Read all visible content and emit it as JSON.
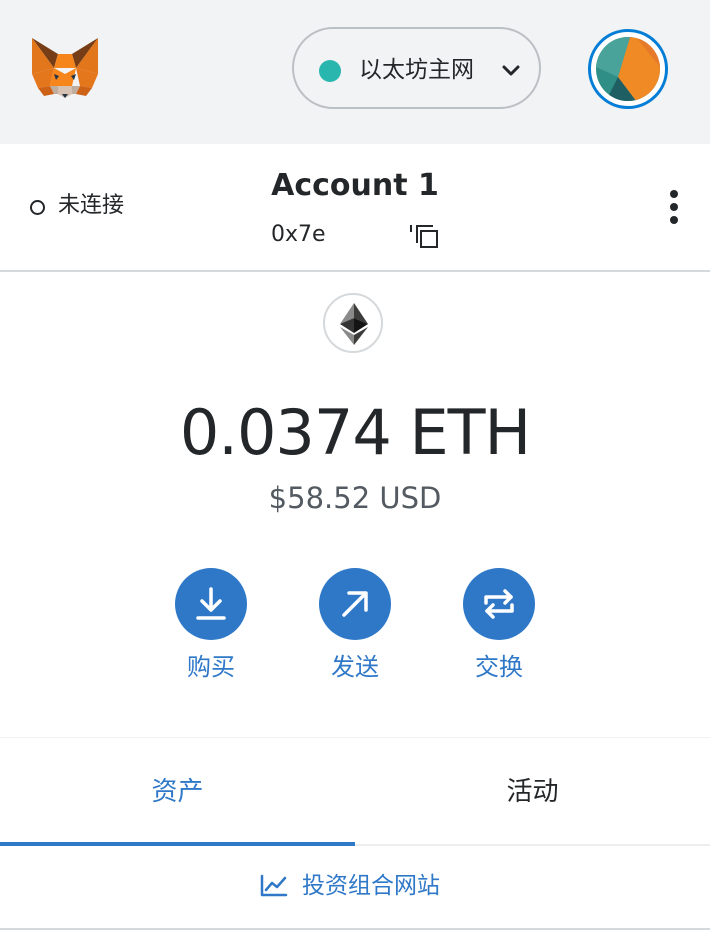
{
  "header": {
    "network": {
      "label": "以太坊主网",
      "status_color": "#29b6af"
    },
    "logo_icon": "metamask-fox-icon",
    "avatar_icon": "account-identicon"
  },
  "account": {
    "connection_status": "未连接",
    "name": "Account 1",
    "address": "0x7e",
    "copy_icon": "copy-icon",
    "menu_icon": "kebab-menu-icon"
  },
  "balance": {
    "token_icon": "ethereum-icon",
    "amount": "0.0374 ETH",
    "fiat": "$58.52 USD"
  },
  "actions": [
    {
      "label": "购买",
      "icon": "download-icon"
    },
    {
      "label": "发送",
      "icon": "arrow-up-right-icon"
    },
    {
      "label": "交换",
      "icon": "swap-icon"
    }
  ],
  "tabs": [
    {
      "label": "资产",
      "active": true
    },
    {
      "label": "活动",
      "active": false
    }
  ],
  "portfolio_link": {
    "label": "投资组合网站",
    "icon": "chart-line-icon"
  },
  "colors": {
    "accent": "#2f78c8",
    "header_bg": "#f2f3f4",
    "text": "#24272a"
  }
}
